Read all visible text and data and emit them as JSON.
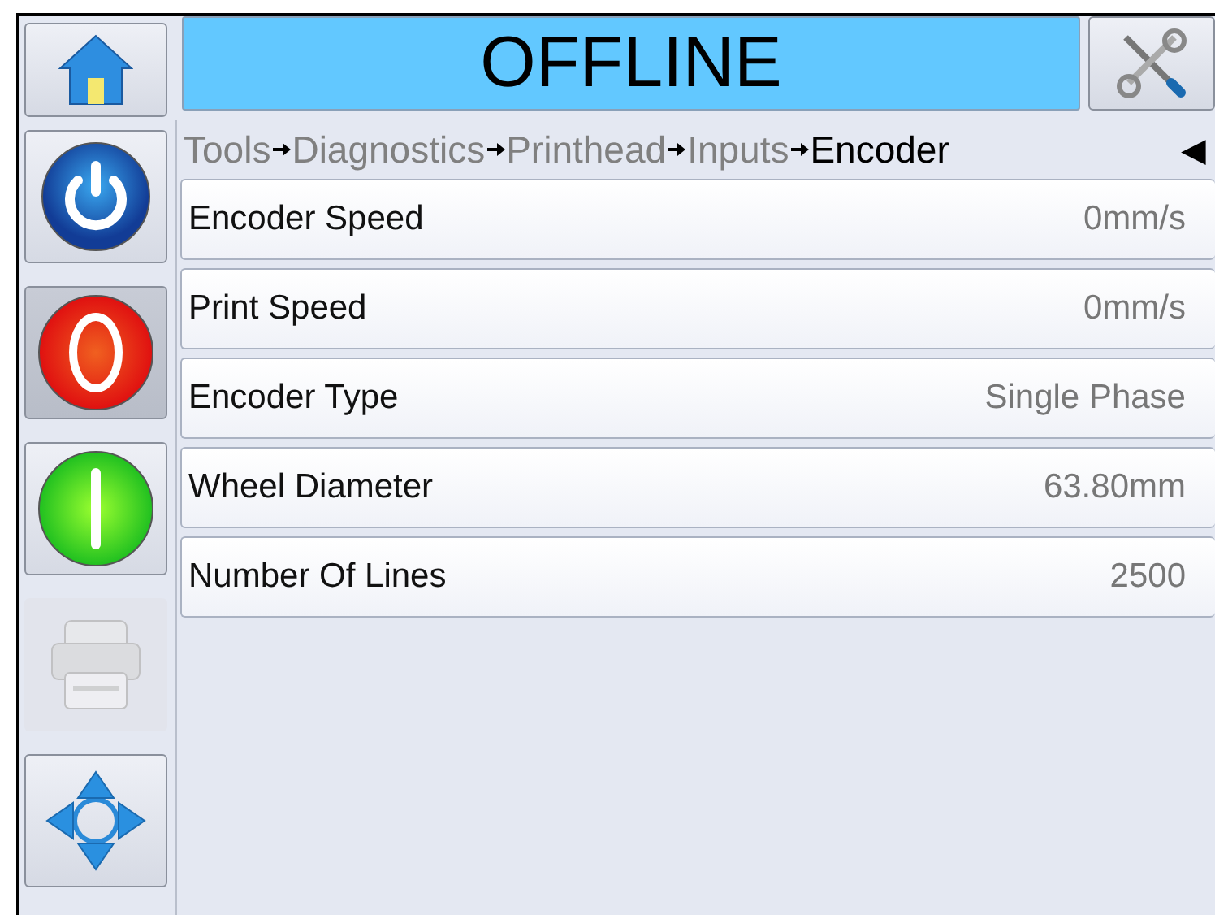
{
  "header": {
    "status": "OFFLINE"
  },
  "sidebar": {
    "buttons": [
      {
        "kind": "power",
        "pressed": false,
        "disabled": false
      },
      {
        "kind": "stop",
        "pressed": true,
        "disabled": false
      },
      {
        "kind": "start",
        "pressed": false,
        "disabled": false
      },
      {
        "kind": "printer",
        "pressed": false,
        "disabled": true
      },
      {
        "kind": "navigate",
        "pressed": false,
        "disabled": false
      }
    ]
  },
  "breadcrumb": {
    "items": [
      {
        "label": "Tools",
        "selected": false
      },
      {
        "label": "Diagnostics",
        "selected": false
      },
      {
        "label": "Printhead",
        "selected": false
      },
      {
        "label": "Inputs",
        "selected": false
      },
      {
        "label": "Encoder",
        "selected": true
      }
    ],
    "back": "◀"
  },
  "rows": [
    {
      "label": "Encoder Speed",
      "value": "0mm/s"
    },
    {
      "label": "Print Speed",
      "value": "0mm/s"
    },
    {
      "label": "Encoder Type",
      "value": "Single Phase"
    },
    {
      "label": "Wheel Diameter",
      "value": "63.80mm"
    },
    {
      "label": "Number Of Lines",
      "value": "2500"
    }
  ]
}
